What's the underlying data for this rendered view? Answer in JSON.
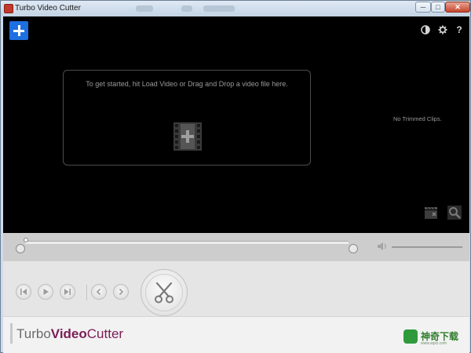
{
  "window": {
    "title": "Turbo Video Cutter",
    "minimize_label": "─",
    "maximize_label": "□",
    "close_label": "✕"
  },
  "video_area": {
    "dropzone_text": "To get started, hit Load Video or Drag and Drop a video file here.",
    "trimmed_clips_label": "No Trimmed Clips."
  },
  "icons": {
    "add": "plus-icon",
    "theme": "contrast-icon",
    "settings": "gear-icon",
    "help_label": "?",
    "film": "film-add-icon",
    "export": "clapper-export-icon",
    "zoom": "magnifier-icon",
    "volume": "speaker-icon",
    "scissors": "scissors-icon"
  },
  "controls": {
    "buttons": [
      "skip-back",
      "play",
      "skip-forward",
      "prev-mark",
      "next-mark"
    ]
  },
  "brand": {
    "logo_part1": "Turbo",
    "logo_part2": "Video",
    "logo_part3": "Cutter",
    "watermark_text": "神奇下载",
    "watermark_sub": "www.sqxz.com"
  },
  "colors": {
    "accent": "#1e6fe0",
    "brand": "#7b1d55"
  }
}
